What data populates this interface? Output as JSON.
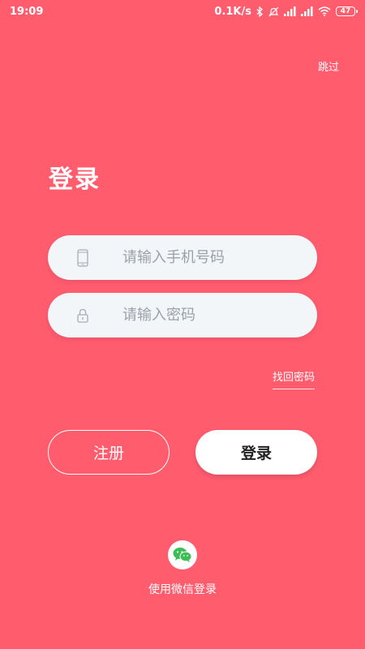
{
  "status_bar": {
    "time": "19:09",
    "network_speed": "0.1K/s",
    "battery": "47"
  },
  "header": {
    "skip_label": "跳过"
  },
  "login_form": {
    "title": "登录",
    "phone_placeholder": "请输入手机号码",
    "password_placeholder": "请输入密码",
    "phone_icon": "phone-icon",
    "lock_icon": "lock-icon",
    "forgot_label": "找回密码"
  },
  "actions": {
    "register_label": "注册",
    "login_label": "登录"
  },
  "wechat": {
    "icon": "wechat-icon",
    "label": "使用微信登录",
    "color": "#3DBE54"
  },
  "colors": {
    "background": "#FF5C6E",
    "field_bg": "#F3F6F9",
    "placeholder": "#9AA1A8"
  }
}
